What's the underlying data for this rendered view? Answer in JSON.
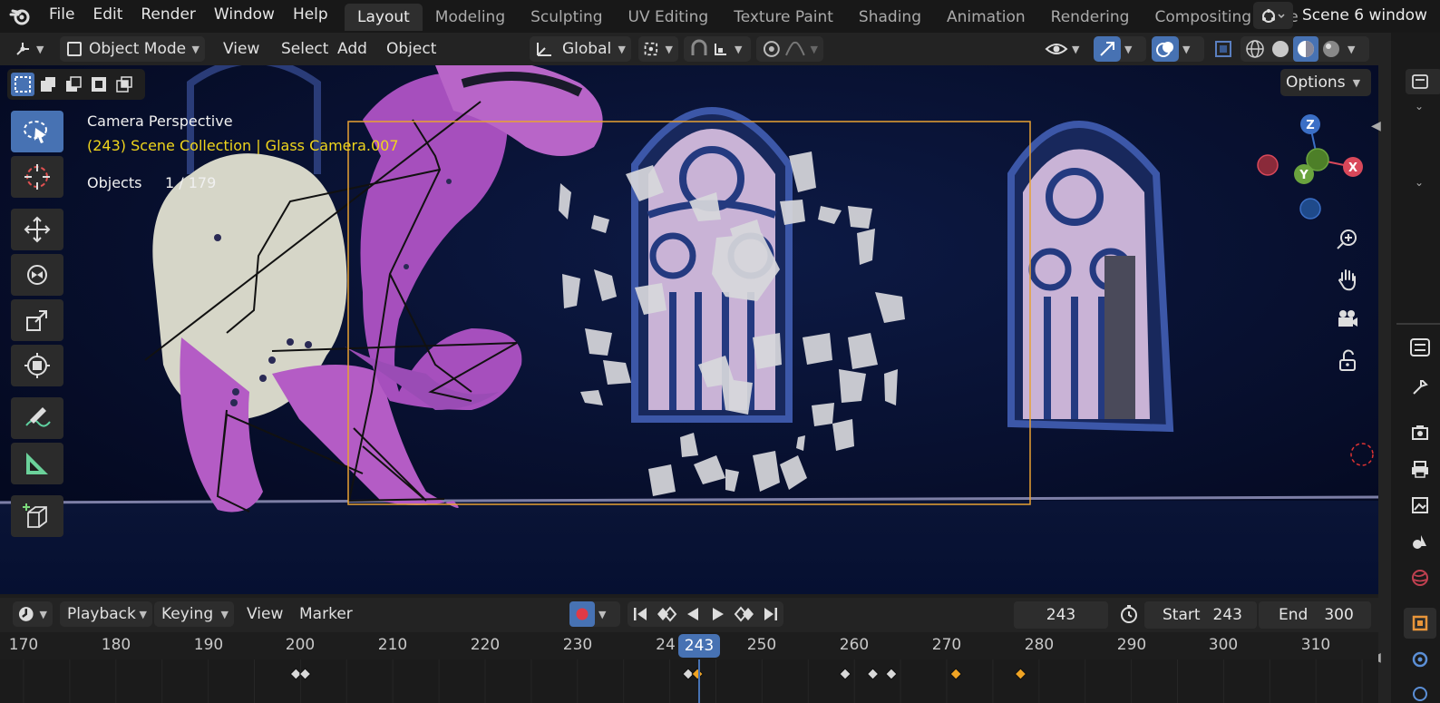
{
  "menu": [
    "File",
    "Edit",
    "Render",
    "Window",
    "Help"
  ],
  "workspaces": [
    "Layout",
    "Modeling",
    "Sculpting",
    "UV Editing",
    "Texture Paint",
    "Shading",
    "Animation",
    "Rendering",
    "Compositing",
    "Ge"
  ],
  "scene_name": "Scene 6 window",
  "viewport_header": {
    "mode": "Object Mode",
    "menus": [
      "View",
      "Select",
      "Add",
      "Object"
    ],
    "orientation": "Global"
  },
  "options_label": "Options",
  "overlay": {
    "perspective": "Camera Perspective",
    "collection": "(243) Scene Collection | Glass Camera.007",
    "objects_label": "Objects",
    "objects_count": "1 / 179"
  },
  "gizmo": {
    "z": "Z",
    "y": "Y",
    "x": "X"
  },
  "timeline": {
    "menus": [
      "Playback",
      "Keying",
      "View",
      "Marker"
    ],
    "current_frame": "243",
    "start_label": "Start",
    "start": "243",
    "end_label": "End",
    "end": "300",
    "ruler_ticks": [
      "170",
      "180",
      "190",
      "200",
      "210",
      "220",
      "230",
      "24",
      "250",
      "260",
      "270",
      "280",
      "290",
      "300",
      "310"
    ],
    "playhead_label": "243",
    "keyframes": [
      {
        "frame": 199.5,
        "selected": false
      },
      {
        "frame": 200.5,
        "selected": false
      },
      {
        "frame": 242.0,
        "selected": false
      },
      {
        "frame": 243.0,
        "selected": true
      },
      {
        "frame": 259.0,
        "selected": false
      },
      {
        "frame": 262.0,
        "selected": false
      },
      {
        "frame": 264.0,
        "selected": false
      },
      {
        "frame": 271.0,
        "selected": true
      },
      {
        "frame": 278.0,
        "selected": true
      }
    ]
  },
  "colors": {
    "accent": "#4772b3",
    "camera_frame": "#e8a132",
    "active_text": "#f0d51c",
    "keyframe_selected": "#f0a424"
  }
}
